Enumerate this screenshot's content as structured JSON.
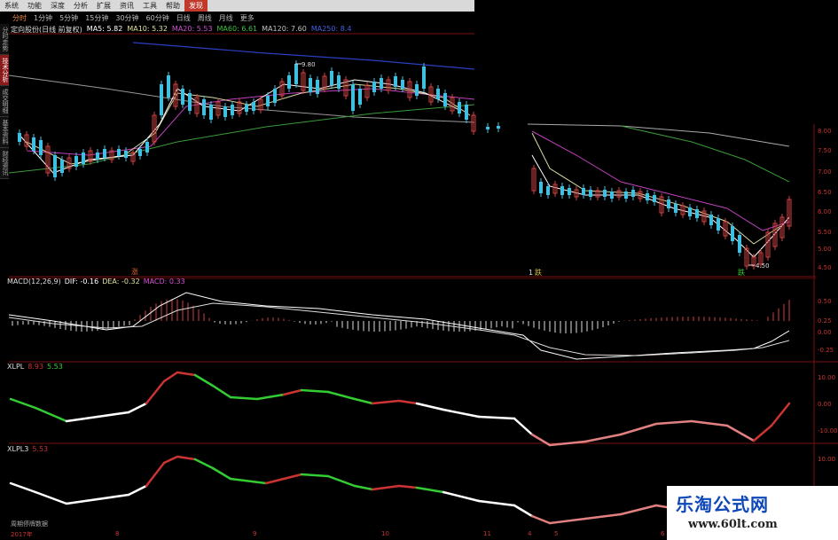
{
  "menu": {
    "items": [
      "系统",
      "功能",
      "深度",
      "分析",
      "扩展",
      "资讯",
      "工具",
      "帮助"
    ],
    "active_item": "发现"
  },
  "periods": {
    "items": [
      "分时",
      "1分钟",
      "5分钟",
      "15分钟",
      "30分钟",
      "60分钟",
      "日线",
      "周线",
      "月线",
      "更多"
    ],
    "active": "分时"
  },
  "side_tabs": [
    "分时走势",
    "技术分析",
    "成交明细",
    "基本资料",
    "财经资讯"
  ],
  "ma_legend": {
    "title": "定向股份(日线 前复权)",
    "items": [
      {
        "label": "MA5: 5.82",
        "color": "#ffffff"
      },
      {
        "label": "MA10: 5.32",
        "color": "#e0e0a0"
      },
      {
        "label": "MA20: 5.53",
        "color": "#d050d0"
      },
      {
        "label": "MA60: 6.61",
        "color": "#40c040"
      },
      {
        "label": "MA120: 7.60",
        "color": "#c0c0c0"
      },
      {
        "label": "MA250: 8.4",
        "color": "#4060e0"
      }
    ]
  },
  "price_labels": {
    "high": "9.80",
    "low": "4.50"
  },
  "price_axis": [
    "8.00",
    "7.50",
    "7.00",
    "6.50",
    "6.00",
    "5.50",
    "5.00",
    "4.50"
  ],
  "markers": {
    "a": "涨",
    "b": "1",
    "c": "跌",
    "d": "跌"
  },
  "macd": {
    "label": "MACD(12,26,9)",
    "dif": "DIF: -0.16",
    "dea": "DEA: -0.32",
    "macd": "MACD: 0.33",
    "axis": [
      "0.50",
      "0.25",
      "0.00",
      "-0.25"
    ]
  },
  "xlpl": {
    "label": "XLPL",
    "v1": "8.93",
    "v2": "5.53",
    "axis": [
      "10.00",
      "0.00",
      "-10.00"
    ]
  },
  "xlpl3": {
    "label": "XLPL3",
    "v1": "5.53",
    "axis": [
      "10.00"
    ]
  },
  "time_axis": [
    "2017年",
    "8",
    "9",
    "10",
    "11",
    "4",
    "5",
    "6"
  ],
  "bottom_note": "周期停牌数据",
  "watermark": {
    "title": "乐淘公式网",
    "url": "www.60lt.com"
  },
  "colors": {
    "red": "#cc3333",
    "green": "#33cc33",
    "panel_border": "#7a0f0f"
  }
}
